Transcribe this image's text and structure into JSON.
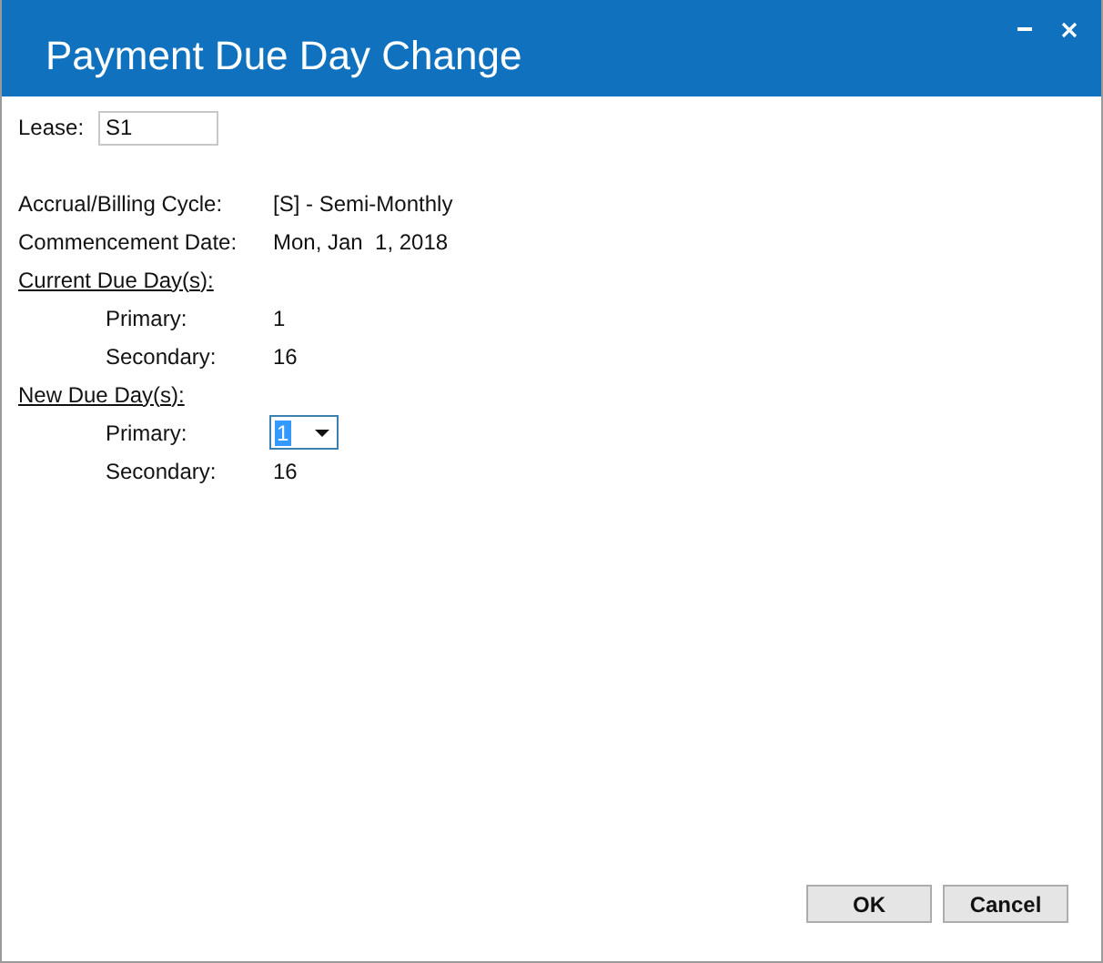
{
  "window": {
    "title": "Payment Due Day Change"
  },
  "lease": {
    "label": "Lease:",
    "value": "S1"
  },
  "rows": [
    {
      "kind": "info",
      "label": "Accrual/Billing Cycle:",
      "value": "[S] - Semi-Monthly"
    },
    {
      "kind": "info",
      "label": "Commencement Date:",
      "value": "Mon, Jan  1, 2018"
    },
    {
      "kind": "heading",
      "label": "Current Due Day(s):"
    },
    {
      "kind": "sub",
      "label": "Primary:",
      "value": "1"
    },
    {
      "kind": "sub",
      "label": "Secondary:",
      "value": "16"
    },
    {
      "kind": "heading",
      "label": "New Due Day(s):"
    },
    {
      "kind": "select",
      "label": "Primary:",
      "value": "1"
    },
    {
      "kind": "sub",
      "label": "Secondary:",
      "value": "16"
    }
  ],
  "buttons": [
    "OK",
    "Cancel"
  ]
}
